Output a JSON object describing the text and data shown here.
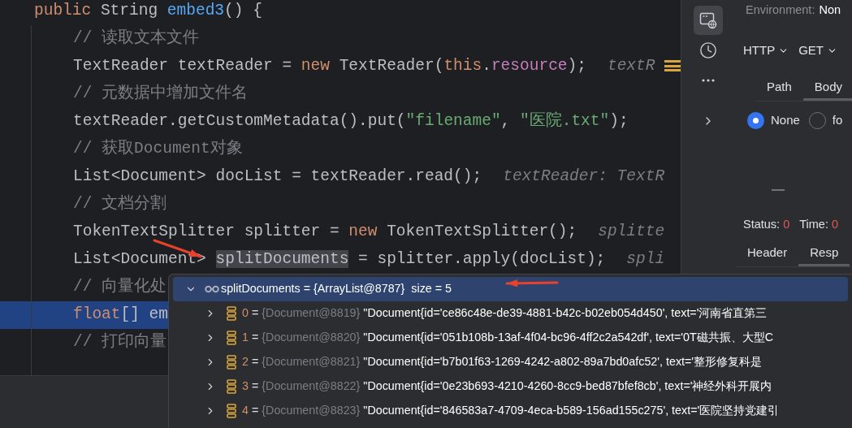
{
  "editor": {
    "lines": [
      {
        "indented": false,
        "highlighted": false,
        "tokens": [
          {
            "kind": "keyword",
            "text": "public"
          },
          {
            "kind": "plain",
            "text": " String "
          },
          {
            "kind": "function",
            "text": "embed3"
          },
          {
            "kind": "plain",
            "text": "() {"
          }
        ]
      },
      {
        "indented": true,
        "highlighted": false,
        "tokens": [
          {
            "kind": "comment",
            "text": "// 读取文本文件"
          }
        ]
      },
      {
        "indented": true,
        "highlighted": false,
        "tokens": [
          {
            "kind": "plain",
            "text": "TextReader textReader = "
          },
          {
            "kind": "keyword",
            "text": "new"
          },
          {
            "kind": "plain",
            "text": " TextReader("
          },
          {
            "kind": "keyword",
            "text": "this"
          },
          {
            "kind": "plain",
            "text": "."
          },
          {
            "kind": "field",
            "text": "resource"
          },
          {
            "kind": "plain",
            "text": ");"
          }
        ],
        "hint": "textR"
      },
      {
        "indented": true,
        "highlighted": false,
        "tokens": [
          {
            "kind": "comment",
            "text": "// 元数据中增加文件名"
          }
        ]
      },
      {
        "indented": true,
        "highlighted": false,
        "tokens": [
          {
            "kind": "plain",
            "text": "textReader.getCustomMetadata().put("
          },
          {
            "kind": "string",
            "text": "\"filename\""
          },
          {
            "kind": "plain",
            "text": ", "
          },
          {
            "kind": "string",
            "text": "\"医院.txt\""
          },
          {
            "kind": "plain",
            "text": ");"
          }
        ]
      },
      {
        "indented": true,
        "highlighted": false,
        "tokens": [
          {
            "kind": "comment",
            "text": "// 获取Document对象"
          }
        ]
      },
      {
        "indented": true,
        "highlighted": false,
        "tokens": [
          {
            "kind": "plain",
            "text": "List<Document> docList = textReader.read();"
          }
        ],
        "hint": "textReader: TextR"
      },
      {
        "indented": true,
        "highlighted": false,
        "tokens": [
          {
            "kind": "comment",
            "text": "// 文档分割"
          }
        ]
      },
      {
        "indented": true,
        "highlighted": false,
        "tokens": [
          {
            "kind": "plain",
            "text": "TokenTextSplitter splitter = "
          },
          {
            "kind": "keyword",
            "text": "new"
          },
          {
            "kind": "plain",
            "text": " TokenTextSplitter();"
          }
        ],
        "hint": "splitte"
      },
      {
        "indented": true,
        "highlighted": false,
        "tokens": [
          {
            "kind": "plain",
            "text": "List<Document> "
          },
          {
            "kind": "selection",
            "text": "splitDocuments"
          },
          {
            "kind": "plain",
            "text": " = splitter.apply(docList);"
          }
        ],
        "hint": "spli"
      },
      {
        "indented": true,
        "highlighted": false,
        "tokens": [
          {
            "kind": "comment",
            "text": "// 向量化处"
          }
        ]
      },
      {
        "indented": true,
        "highlighted": true,
        "tokens": [
          {
            "kind": "keyword",
            "text": "float"
          },
          {
            "kind": "plain",
            "text": "[] em"
          }
        ]
      },
      {
        "indented": true,
        "highlighted": false,
        "tokens": [
          {
            "kind": "comment",
            "text": "// 打印向量"
          }
        ]
      }
    ]
  },
  "debugger_popup": {
    "header": {
      "selected": true,
      "expanded": true,
      "name": "splitDocuments",
      "value": "= {ArrayList@8787}",
      "size": "size = 5"
    },
    "rows": [
      {
        "selected": false,
        "expanded": false,
        "index": "0",
        "equals": "=",
        "ref": "{Document@8819}",
        "value": "\"Document{id='ce86c48e-de39-4881-b42c-b02eb054d450', text='河南省直第三"
      },
      {
        "selected": false,
        "expanded": false,
        "index": "1",
        "equals": "=",
        "ref": "{Document@8820}",
        "value": "\"Document{id='051b108b-13af-4f04-bc96-4ff2c2a542df', text='0T磁共振、大型C"
      },
      {
        "selected": false,
        "expanded": false,
        "index": "2",
        "equals": "=",
        "ref": "{Document@8821}",
        "value": "\"Document{id='b7b01f63-1269-4242-a802-89a7bd0afc52', text='整形修复科是"
      },
      {
        "selected": false,
        "expanded": false,
        "index": "3",
        "equals": "=",
        "ref": "{Document@8822}",
        "value": "\"Document{id='0e23b693-4210-4260-8cc9-bed87bfef8cb', text='神经外科开展内"
      },
      {
        "selected": false,
        "expanded": false,
        "index": "4",
        "equals": "=",
        "ref": "{Document@8823}",
        "value": "\"Document{id='846583a7-4709-4eca-b589-156ad155c275', text='医院坚持党建引"
      }
    ]
  },
  "side_panel": {
    "tool_icons": [
      {
        "kind": "http",
        "selected": true
      },
      {
        "kind": "history",
        "selected": false
      },
      {
        "kind": "more",
        "selected": false
      },
      {
        "kind": "expand",
        "selected": false
      }
    ],
    "environment_label": "Environment:",
    "environment_value": "Non",
    "protocol": "HTTP",
    "method": "GET",
    "request_tabs": [
      {
        "label": "Path",
        "selected": false
      },
      {
        "label": "Body",
        "selected": true
      }
    ],
    "body_types": [
      {
        "label": "None",
        "selected": true
      },
      {
        "label": "fo",
        "selected": false
      }
    ],
    "status_label": "Status:",
    "status_value": "0",
    "time_label": "Time:",
    "time_value": "0",
    "response_tabs": [
      {
        "label": "Header",
        "selected": false
      },
      {
        "label": "Resp",
        "selected": true
      }
    ]
  }
}
